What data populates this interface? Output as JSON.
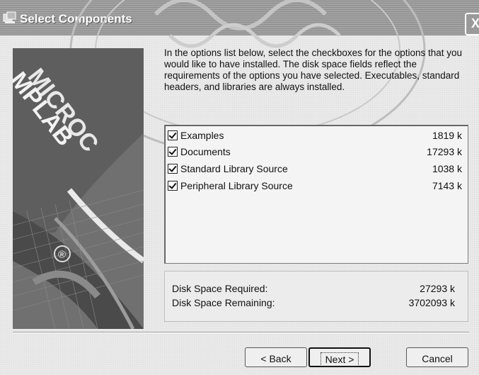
{
  "window": {
    "title": "Select Components",
    "title_icon": "setup-icon",
    "close_label": "X"
  },
  "description": "In the options list below, select the checkboxes for the options that you would like to have installed.  The disk space fields reflect the requirements of the options you have selected. Executables, standard headers, and libraries are always installed.",
  "options": [
    {
      "label": "Examples",
      "size": "1819 k",
      "checked": true
    },
    {
      "label": "Documents",
      "size": "17293 k",
      "checked": true
    },
    {
      "label": "Standard Library Source",
      "size": "1038 k",
      "checked": true
    },
    {
      "label": "Peripheral Library Source",
      "size": "7143 k",
      "checked": true
    }
  ],
  "disk": {
    "required_label": "Disk Space Required:",
    "required_value": "27293 k",
    "remaining_label": "Disk Space Remaining:",
    "remaining_value": "3702093 k"
  },
  "buttons": {
    "back": "< Back",
    "next": "Next >",
    "cancel": "Cancel"
  },
  "side_graphic": {
    "logo_text_1": "MICROC",
    "logo_text_2": "MPLAB",
    "registered_mark": "®"
  }
}
